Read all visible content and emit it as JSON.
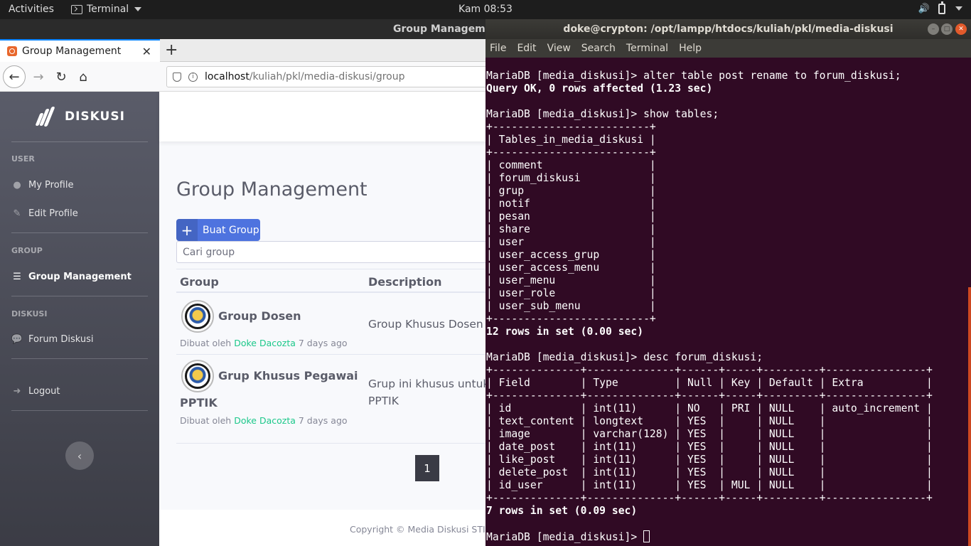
{
  "topbar": {
    "activities": "Activities",
    "app_name": "Terminal",
    "clock": "Kam 08:53"
  },
  "firefox": {
    "window_title": "Group Management - Mozilla Firefox",
    "tab_title": "Group Management",
    "url_host": "localhost",
    "url_path": "/kuliah/pkl/media-diskusi/group"
  },
  "app": {
    "brand": "DISKUSI",
    "sidebar": {
      "section_user": "USER",
      "my_profile": "My Profile",
      "edit_profile": "Edit Profile",
      "section_group": "GROUP",
      "group_management": "Group Management",
      "section_diskusi": "DISKUSI",
      "forum_diskusi": "Forum Diskusi",
      "logout": "Logout"
    },
    "page_title": "Group Management",
    "add_button": "Buat Group",
    "search_placeholder": "Cari group",
    "table": {
      "col_group": "Group",
      "col_description": "Description"
    },
    "groups": [
      {
        "name": "Group Dosen",
        "by_prefix": "Dibuat oleh",
        "author": "Doke Dacozta",
        "age": "7 days ago",
        "description": "Group Khusus Dosen S"
      },
      {
        "name_line1": "Grup Khusus Pegawai",
        "name_line2": "PPTIK",
        "by_prefix": "Dibuat oleh",
        "author": "Doke Dacozta",
        "age": "7 days ago",
        "description_line1": "Grup ini khusus untuk a",
        "description_line2": "PPTIK"
      }
    ],
    "pagination_current": "1",
    "footer": "Copyright © Media Diskusi STIKI"
  },
  "terminal": {
    "title": "doke@crypton: /opt/lampp/htdocs/kuliah/pkl/media-diskusi",
    "menu": [
      "File",
      "Edit",
      "View",
      "Search",
      "Terminal",
      "Help"
    ],
    "output": "MariaDB [media_diskusi]> alter table post rename to forum_diskusi;\n<b>Query OK, 0 rows affected (1.23 sec)</b>\n\nMariaDB [media_diskusi]> show tables;\n+-------------------------+\n| Tables_in_media_diskusi |\n+-------------------------+\n| comment                 |\n| forum_diskusi           |\n| grup                    |\n| notif                   |\n| pesan                   |\n| share                   |\n| user                    |\n| user_access_grup        |\n| user_access_menu        |\n| user_menu               |\n| user_role               |\n| user_sub_menu           |\n+-------------------------+\n<b>12 rows in set (0.00 sec)</b>\n\nMariaDB [media_diskusi]> desc forum_diskusi;\n+--------------+--------------+------+-----+---------+----------------+\n| Field        | Type         | Null | Key | Default | Extra          |\n+--------------+--------------+------+-----+---------+----------------+\n| id           | int(11)      | NO   | PRI | NULL    | auto_increment |\n| text_content | longtext     | YES  |     | NULL    |                |\n| image        | varchar(128) | YES  |     | NULL    |                |\n| date_post    | int(11)      | YES  |     | NULL    |                |\n| like_post    | int(11)      | YES  |     | NULL    |                |\n| delete_post  | int(11)      | YES  |     | NULL    |                |\n| id_user      | int(11)      | YES  | MUL | NULL    |                |\n+--------------+--------------+------+-----+---------+----------------+\n<b>7 rows in set (0.09 sec)</b>\n\nMariaDB [media_diskusi]> "
  }
}
